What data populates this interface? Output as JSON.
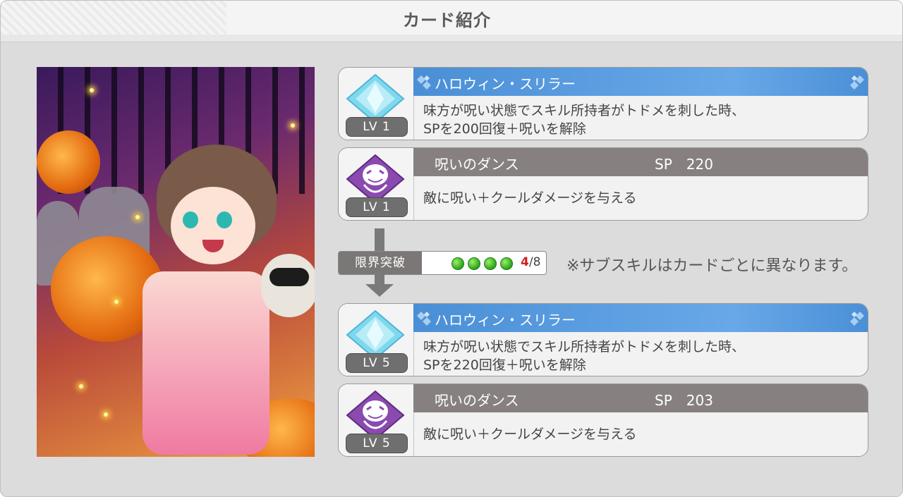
{
  "header": {
    "title": "カード紹介"
  },
  "before": [
    {
      "type": "support",
      "level": "LV 1",
      "name": "ハロウィン・スリラー",
      "sp": "",
      "desc_line1": "味方が呪い状態でスキル所持者がトドメを刺した時、",
      "desc_line2": "SPを200回復＋呪いを解除"
    },
    {
      "type": "skill",
      "level": "LV 1",
      "name": "呪いのダンス",
      "sp": "SP　220",
      "desc_line1": "敵に呪い＋クールダメージを与える",
      "desc_line2": ""
    }
  ],
  "limit_break": {
    "label": "限界突破",
    "current": "4",
    "total": "/8",
    "filled": 4
  },
  "note": "※サブスキルはカードごとに異なります。",
  "after": [
    {
      "type": "support",
      "level": "LV 5",
      "name": "ハロウィン・スリラー",
      "sp": "",
      "desc_line1": "味方が呪い状態でスキル所持者がトドメを刺した時、",
      "desc_line2": "SPを220回復＋呪いを解除"
    },
    {
      "type": "skill",
      "level": "LV 5",
      "name": "呪いのダンス",
      "sp": "SP　203",
      "desc_line1": "敵に呪い＋クールダメージを与える",
      "desc_line2": ""
    }
  ],
  "colors": {
    "support_header": "#4a8fd6",
    "skill_header": "#868180",
    "gem_support": "#7fd8ec",
    "gem_skill": "#8a4ab0"
  }
}
